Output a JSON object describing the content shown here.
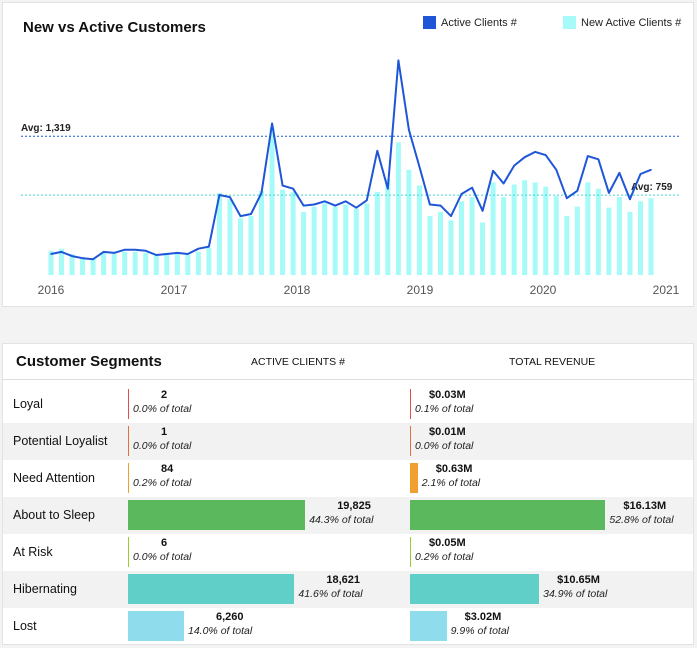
{
  "chart": {
    "title": "New vs Active Customers",
    "legend": [
      {
        "label": "Active Clients #",
        "color": "#1f56d8"
      },
      {
        "label": "New Active Clients #",
        "color": "#a6faf7"
      }
    ]
  },
  "chart_data": {
    "type": "line",
    "x_tick_labels": [
      "2016",
      "2017",
      "2018",
      "2019",
      "2020",
      "2021"
    ],
    "series": [
      {
        "name": "Active Clients #",
        "type": "line",
        "color": "#1f56d8",
        "values": [
          200,
          220,
          180,
          160,
          150,
          220,
          210,
          240,
          240,
          230,
          190,
          200,
          210,
          200,
          250,
          270,
          760,
          740,
          560,
          580,
          780,
          1440,
          850,
          820,
          660,
          670,
          700,
          660,
          700,
          640,
          710,
          1180,
          820,
          2040,
          1380,
          1030,
          670,
          660,
          560,
          770,
          830,
          610,
          990,
          870,
          1040,
          1120,
          1170,
          1140,
          1000,
          730,
          800,
          1130,
          1100,
          780,
          970,
          720,
          960,
          1000
        ]
      },
      {
        "name": "New Active Clients #",
        "type": "bar",
        "color": "#a6faf7",
        "values": [
          230,
          250,
          200,
          170,
          160,
          210,
          200,
          220,
          220,
          210,
          190,
          210,
          200,
          190,
          220,
          260,
          780,
          720,
          540,
          560,
          800,
          1400,
          810,
          790,
          600,
          650,
          680,
          650,
          670,
          630,
          680,
          790,
          910,
          1260,
          1000,
          850,
          560,
          600,
          520,
          700,
          740,
          500,
          880,
          740,
          860,
          900,
          880,
          840,
          750,
          560,
          650,
          880,
          820,
          640,
          740,
          600,
          700,
          730
        ]
      }
    ],
    "avg_lines": [
      {
        "label": "Avg: 1,319",
        "value": 1319,
        "color": "#1f56d8"
      },
      {
        "label": "Avg: 759",
        "value": 759,
        "color": "#45d8d0"
      }
    ],
    "ylim": [
      0,
      2300
    ]
  },
  "segments": {
    "title": "Customer Segments",
    "col1": "ACTIVE CLIENTS #",
    "col2": "TOTAL REVENUE",
    "rows": [
      {
        "name": "Loyal",
        "clients": "2",
        "clients_pct": "0.0% of total",
        "clients_frac": 0.0,
        "revenue": "$0.03M",
        "revenue_pct": "0.1% of total",
        "revenue_frac": 0.001,
        "color": "#e05050"
      },
      {
        "name": "Potential Loyalist",
        "clients": "1",
        "clients_pct": "0.0% of total",
        "clients_frac": 0.0,
        "revenue": "$0.01M",
        "revenue_pct": "0.0% of total",
        "revenue_frac": 0.0,
        "color": "#e07040"
      },
      {
        "name": "Need Attention",
        "clients": "84",
        "clients_pct": "0.2% of total",
        "clients_frac": 0.002,
        "revenue": "$0.63M",
        "revenue_pct": "2.1% of total",
        "revenue_frac": 0.021,
        "color": "#f0a030"
      },
      {
        "name": "About to Sleep",
        "clients": "19,825",
        "clients_pct": "44.3% of total",
        "clients_frac": 0.443,
        "revenue": "$16.13M",
        "revenue_pct": "52.8% of total",
        "revenue_frac": 0.528,
        "color": "#5cb85c"
      },
      {
        "name": "At Risk",
        "clients": "6",
        "clients_pct": "0.0% of total",
        "clients_frac": 0.0,
        "revenue": "$0.05M",
        "revenue_pct": "0.2% of total",
        "revenue_frac": 0.002,
        "color": "#9acd32"
      },
      {
        "name": "Hibernating",
        "clients": "18,621",
        "clients_pct": "41.6% of total",
        "clients_frac": 0.416,
        "revenue": "$10.65M",
        "revenue_pct": "34.9% of total",
        "revenue_frac": 0.349,
        "color": "#60cfc8"
      },
      {
        "name": "Lost",
        "clients": "6,260",
        "clients_pct": "14.0% of total",
        "clients_frac": 0.14,
        "revenue": "$3.02M",
        "revenue_pct": "9.9% of total",
        "revenue_frac": 0.099,
        "color": "#8fdcec"
      }
    ]
  }
}
